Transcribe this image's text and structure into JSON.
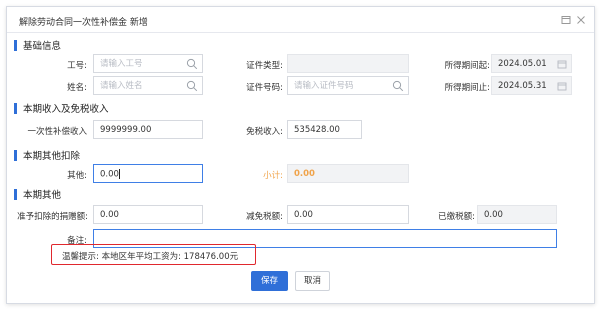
{
  "window": {
    "title": "解除劳动合同一次性补偿金 新增",
    "maximize_icon": "maximize-icon",
    "close_icon": "close-icon"
  },
  "sections": {
    "basic": "基础信息",
    "income": "本期收入及免税收入",
    "other_deduction": "本期其他扣除",
    "other": "本期其他"
  },
  "basic": {
    "employee_id": {
      "label": "工号:",
      "placeholder": "请输入工号"
    },
    "id_type": {
      "label": "证件类型:",
      "value": ""
    },
    "period_start": {
      "label": "所得期间起:",
      "value": "2024.05.01"
    },
    "name": {
      "label": "姓名:",
      "placeholder": "请输入姓名"
    },
    "id_number": {
      "label": "证件号码:",
      "placeholder": "请输入证件号码"
    },
    "period_end": {
      "label": "所得期间止:",
      "value": "2024.05.31"
    }
  },
  "income": {
    "lump_sum": {
      "label": "一次性补偿收入",
      "value": "9999999.00"
    },
    "tax_free": {
      "label": "免税收入:",
      "value": "535428.00"
    }
  },
  "other_deduction": {
    "other": {
      "label": "其他:",
      "value": "0.00"
    },
    "subtotal": {
      "label": "小计:",
      "value": "0.00"
    }
  },
  "other": {
    "donation": {
      "label": "准予扣除的捐赠额:",
      "value": "0.00"
    },
    "tax_reduction": {
      "label": "减免税额:",
      "value": "0.00"
    },
    "tax_paid": {
      "label": "已缴税额:",
      "value": "0.00"
    },
    "remark": {
      "label": "备注:",
      "value": ""
    }
  },
  "hint": "温馨提示: 本地区年平均工资为: 178476.00元",
  "buttons": {
    "save": "保存",
    "cancel": "取消"
  },
  "colors": {
    "primary": "#2f6fd8",
    "highlight_border": "#e0282e",
    "subtotal": "#f0a34a"
  }
}
